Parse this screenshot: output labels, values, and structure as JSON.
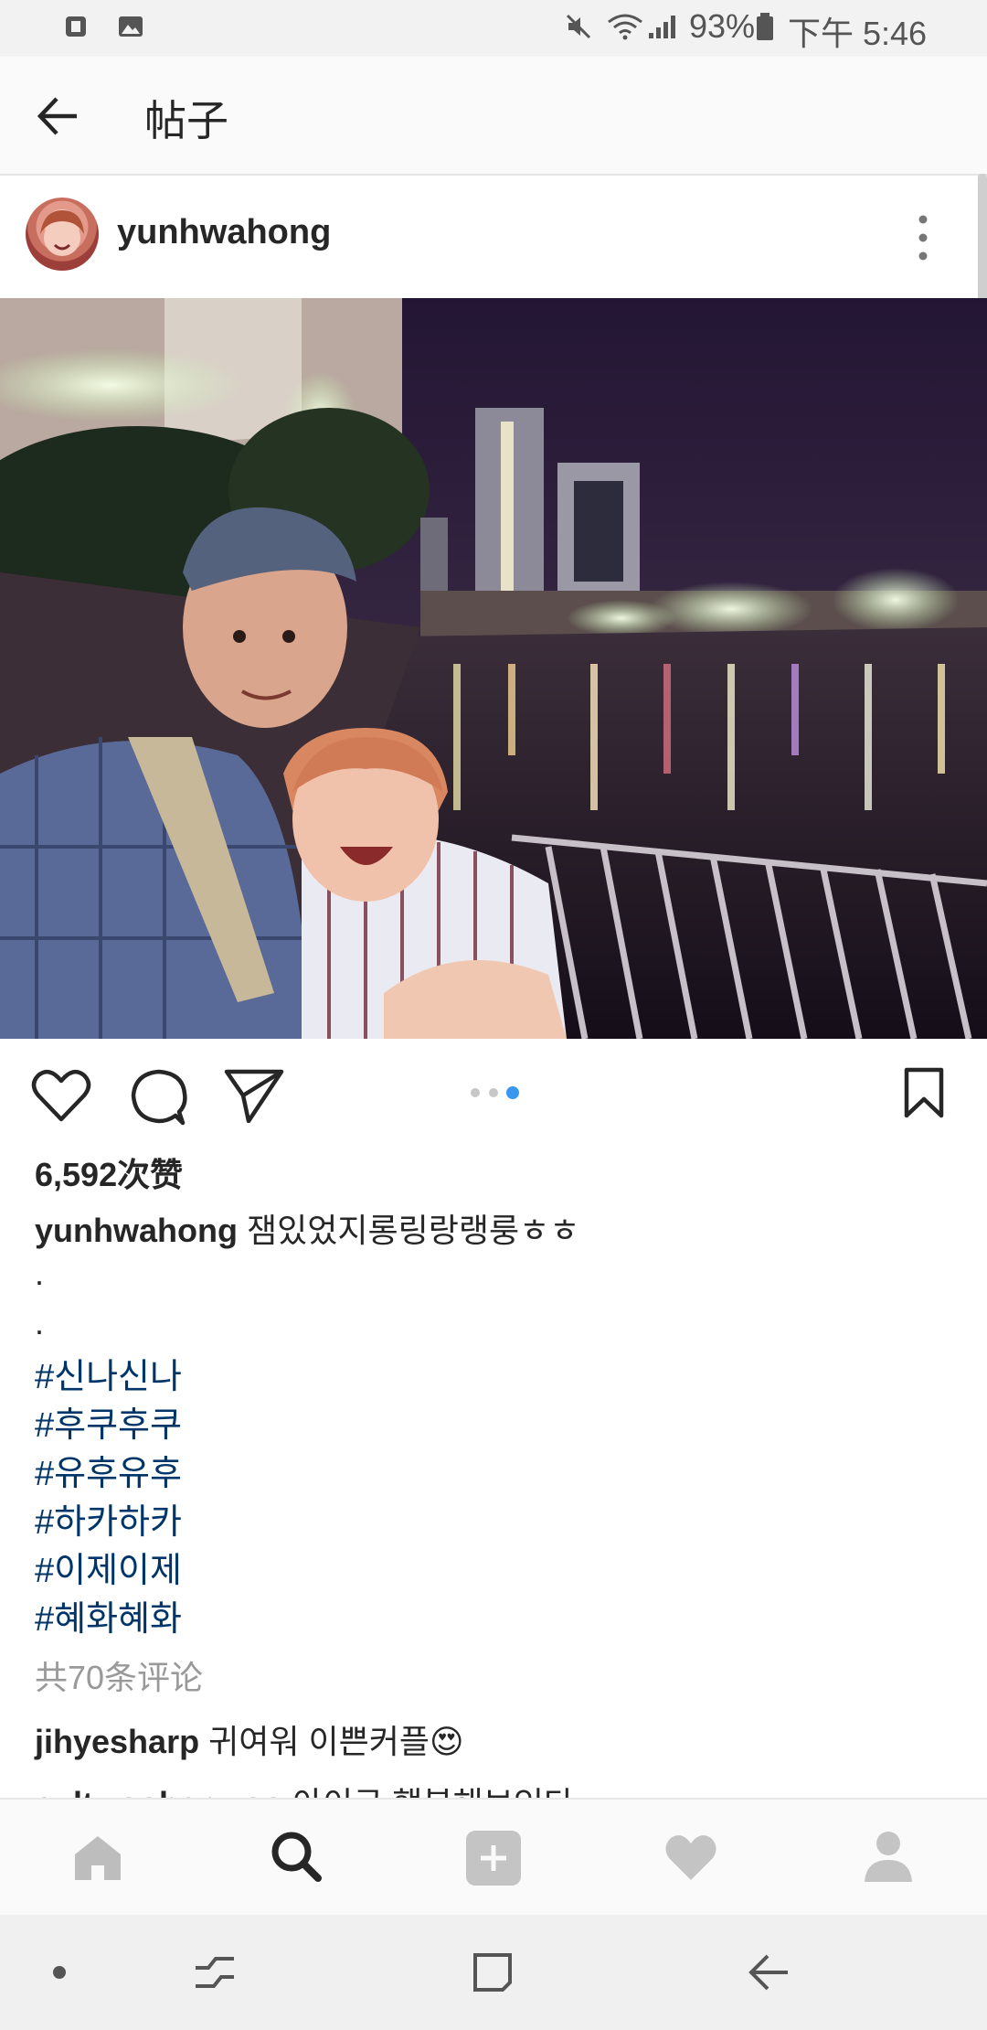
{
  "status_bar": {
    "battery": "93%",
    "time": "下午 5:46"
  },
  "header": {
    "title": "帖子"
  },
  "post": {
    "username": "yunhwahong",
    "likes": "6,592次赞",
    "caption_user": "yunhwahong",
    "caption_text": "잼있었지롱링랑랭룽ㅎㅎ",
    "caption_dots": [
      ".",
      "."
    ],
    "hashtags": [
      "#신나신나",
      "#후쿠후쿠",
      "#유후유후",
      "#하카하카",
      "#이제이제",
      "#혜화혜화"
    ],
    "comments_count": "共70条评论",
    "comments": [
      {
        "user": "jihyesharp",
        "text": "귀여워 이쁜커플",
        "emoji": "😍"
      },
      {
        "user": "cultwoohanwoo",
        "text": "아이구 행복해보인다"
      }
    ]
  },
  "bottom_nav": {
    "items": [
      "home-icon",
      "search-icon",
      "add-icon",
      "heart-icon",
      "profile-icon"
    ],
    "active": "search-icon"
  },
  "colors": {
    "hashtag": "#003569",
    "active_dot": "#3897f0",
    "muted": "#999999"
  }
}
